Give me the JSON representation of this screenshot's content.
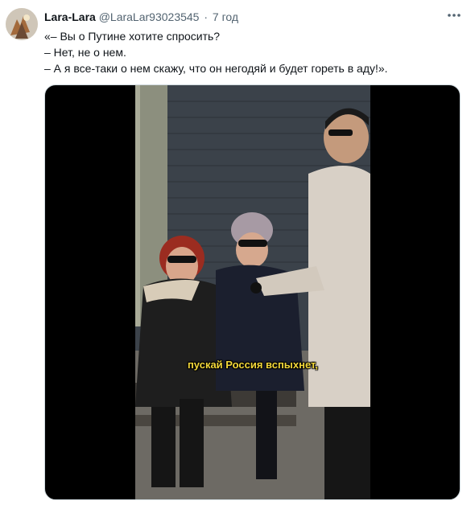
{
  "tweet": {
    "author_name": "Lara-Lara",
    "author_handle": "@LaraLar93023545",
    "separator": "·",
    "timestamp": "7 год",
    "more_icon": "more-dots-icon",
    "text_lines": [
      "«– Вы о Путине хотите спросить?",
      "– Нет, не о нем.",
      "– А я все-таки о нем скажу, что он негодяй и будет гореть в аду!»."
    ]
  },
  "media": {
    "subtitle": "пускай Россия вспыхнет,"
  }
}
